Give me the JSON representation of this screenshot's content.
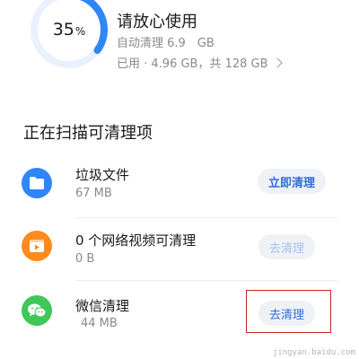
{
  "storage": {
    "percent": "35",
    "percent_unit": "%",
    "percent_value": 0.35,
    "title": "请放心使用",
    "auto_clean": "自动清理 6.9　GB",
    "used": "已用 · 4.96 GB，共 128 GB"
  },
  "section_title": "正在扫描可清理项",
  "items": [
    {
      "title": "垃圾文件",
      "size": "67 MB",
      "button": "立即清理",
      "icon": "folder-icon",
      "color": "#2f86f6"
    },
    {
      "title": "0 个网络视频可清理",
      "size": "0 B",
      "button": "去清理",
      "icon": "video-play-icon",
      "color": "#ff8a1e"
    },
    {
      "title": "微信清理",
      "size": "44 MB",
      "button": "去清理",
      "icon": "wechat-icon",
      "color": "#3fc75a"
    }
  ],
  "watermark": "jingyan.baidu.com",
  "colors": {
    "accent": "#2f86f6",
    "ring_track": "#e9f1fc",
    "highlight": "#c0282a"
  }
}
